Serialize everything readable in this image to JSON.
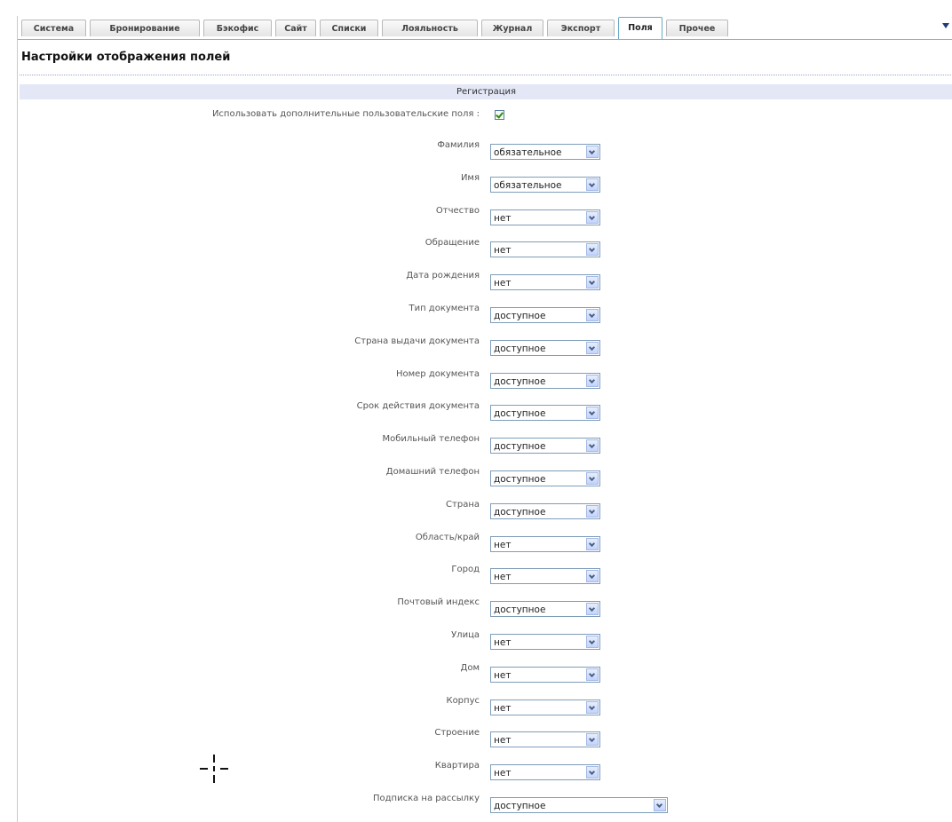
{
  "tabs": [
    {
      "label": "Система",
      "active": false
    },
    {
      "label": "Бронирование",
      "active": false
    },
    {
      "label": "Бэкофис",
      "active": false
    },
    {
      "label": "Сайт",
      "active": false
    },
    {
      "label": "Списки",
      "active": false
    },
    {
      "label": "Лояльность",
      "active": false
    },
    {
      "label": "Журнал",
      "active": false
    },
    {
      "label": "Экспорт",
      "active": false
    },
    {
      "label": "Поля",
      "active": true
    },
    {
      "label": "Прочее",
      "active": false
    }
  ],
  "page": {
    "title": "Настройки отображения полей",
    "section_title": "Регистрация",
    "custom_fields_label": "Использовать дополнительные пользовательские поля :",
    "custom_fields_checked": true
  },
  "fields": [
    {
      "label": "Фамилия",
      "value": "обязательное"
    },
    {
      "label": "Имя",
      "value": "обязательное"
    },
    {
      "label": "Отчество",
      "value": "нет"
    },
    {
      "label": "Обращение",
      "value": "нет"
    },
    {
      "label": "Дата рождения",
      "value": "нет"
    },
    {
      "label": "Тип документа",
      "value": "доступное"
    },
    {
      "label": "Страна выдачи документа",
      "value": "доступное"
    },
    {
      "label": "Номер документа",
      "value": "доступное"
    },
    {
      "label": "Срок действия документа",
      "value": "доступное"
    },
    {
      "label": "Мобильный телефон",
      "value": "доступное"
    },
    {
      "label": "Домашний телефон",
      "value": "доступное"
    },
    {
      "label": "Страна",
      "value": "доступное"
    },
    {
      "label": "Область/край",
      "value": "нет"
    },
    {
      "label": "Город",
      "value": "нет"
    },
    {
      "label": "Почтовый индекс",
      "value": "доступное"
    },
    {
      "label": "Улица",
      "value": "нет"
    },
    {
      "label": "Дом",
      "value": "нет"
    },
    {
      "label": "Корпус",
      "value": "нет"
    },
    {
      "label": "Строение",
      "value": "нет"
    },
    {
      "label": "Квартира",
      "value": "нет"
    },
    {
      "label": "Подписка на рассылку",
      "value": "доступное"
    }
  ],
  "icons": {
    "cursor": "crosshair-cursor-icon",
    "tab_menu": "chevron-down-icon"
  },
  "colors": {
    "section_bg": "#e3e7f6",
    "select_border": "#7f9db9",
    "active_tab_border": "#6aa9c7"
  }
}
